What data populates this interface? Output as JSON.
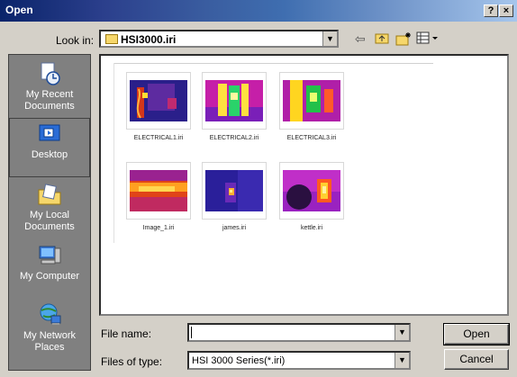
{
  "window": {
    "title": "Open",
    "help_btn": "?",
    "close_btn": "×"
  },
  "lookin": {
    "label": "Look in:",
    "value": "HSI3000.iri"
  },
  "toolbar": {
    "back": "⇦",
    "up": "⬏",
    "new_folder": "✱",
    "views": "▦▾"
  },
  "places": [
    {
      "label": "My Recent Documents",
      "icon": "recent-documents-icon"
    },
    {
      "label": "Desktop",
      "icon": "desktop-icon"
    },
    {
      "label": "My Local Documents",
      "icon": "my-documents-icon"
    },
    {
      "label": "My Computer",
      "icon": "my-computer-icon"
    },
    {
      "label": "My Network Places",
      "icon": "network-places-icon"
    }
  ],
  "files": [
    {
      "name": "ELECTRICAL1.iri"
    },
    {
      "name": "ELECTRICAL2.iri"
    },
    {
      "name": "ELECTRICAL3.iri"
    },
    {
      "name": "Image_1.iri"
    },
    {
      "name": "james.iri"
    },
    {
      "name": "kettle.iri"
    }
  ],
  "filename": {
    "label": "File name:",
    "value": ""
  },
  "filetype": {
    "label": "Files of type:",
    "value": "HSI 3000 Series(*.iri)"
  },
  "buttons": {
    "open": "Open",
    "cancel": "Cancel"
  }
}
